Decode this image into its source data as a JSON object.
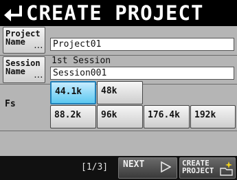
{
  "header": {
    "title": "CREATE PROJECT",
    "back_icon": "return-arrow-icon"
  },
  "project": {
    "button_line1": "Project",
    "button_line2": "Name",
    "button_dots": "...",
    "name_value": "Project01"
  },
  "session": {
    "button_line1": "Session",
    "button_line2": "Name",
    "button_dots": "...",
    "label": "1st Session",
    "name_value": "Session001"
  },
  "fs": {
    "label": "Fs",
    "selected": "44.1k",
    "options": [
      "44.1k",
      "48k",
      "88.2k",
      "96k",
      "176.4k",
      "192k"
    ]
  },
  "footer": {
    "page_indicator": "[1/3]",
    "next_label": "NEXT",
    "next_icon": "play-triangle-icon",
    "create_line1": "CREATE",
    "create_line2": "PROJECT",
    "create_icon": "folder-sparkle-icon"
  },
  "colors": {
    "selected_fill": "#5cc8f0",
    "background": "#b5b5b5",
    "header": "#000000"
  }
}
